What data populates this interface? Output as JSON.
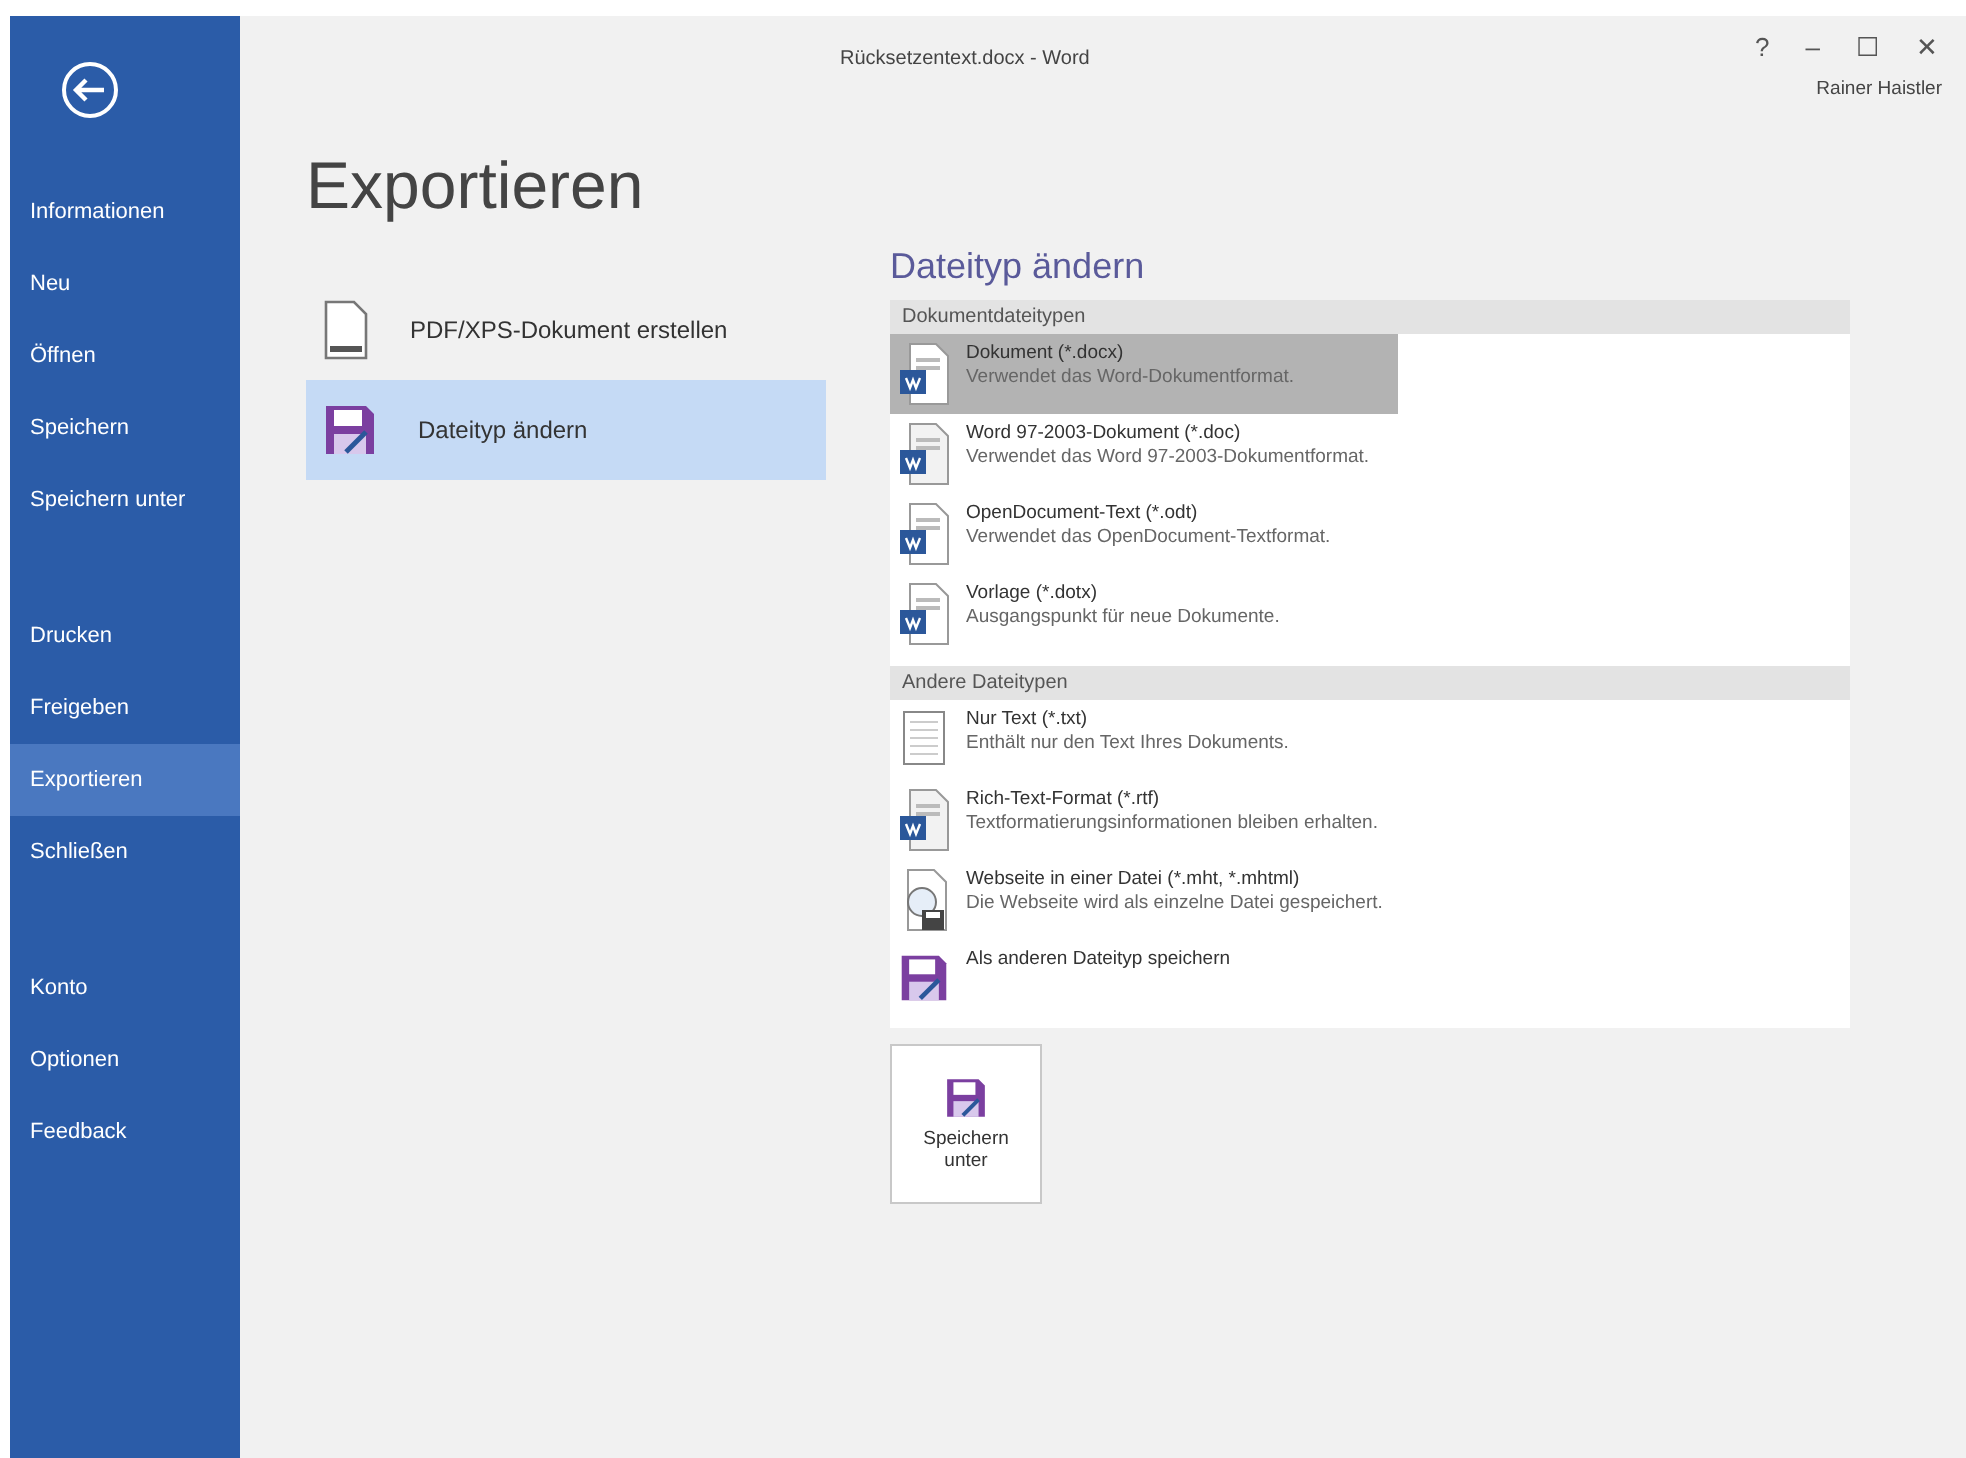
{
  "window": {
    "title": "Rücksetzentext.docx - Word",
    "controls": [
      "?",
      "–",
      "☐",
      "✕"
    ],
    "user": "Rainer Haistler"
  },
  "sidebar": {
    "groups": [
      [
        {
          "label": "Informationen",
          "selected": false
        },
        {
          "label": "Neu",
          "selected": false
        },
        {
          "label": "Öffnen",
          "selected": false
        },
        {
          "label": "Speichern",
          "selected": false
        },
        {
          "label": "Speichern unter",
          "selected": false
        }
      ],
      [
        {
          "label": "Drucken",
          "selected": false
        },
        {
          "label": "Freigeben",
          "selected": false
        },
        {
          "label": "Exportieren",
          "selected": true
        },
        {
          "label": "Schließen",
          "selected": false
        }
      ],
      [
        {
          "label": "Konto",
          "selected": false
        },
        {
          "label": "Optionen",
          "selected": false
        },
        {
          "label": "Feedback",
          "selected": false
        }
      ]
    ]
  },
  "page_title": "Exportieren",
  "options": [
    {
      "kind": "pdf",
      "label": "PDF/XPS-Dokument erstellen",
      "selected": false
    },
    {
      "kind": "save",
      "label": "Dateityp ändern",
      "selected": true
    }
  ],
  "detail": {
    "heading": "Dateityp ändern",
    "sections": [
      {
        "title": "Dokumentdateitypen",
        "items": [
          {
            "kind": "word",
            "name": "Dokument (*.docx)",
            "description": "Verwendet das Word-Dokumentformat.",
            "selected": true
          },
          {
            "kind": "word97",
            "name": "Word 97-2003-Dokument (*.doc)",
            "description": "Verwendet das Word 97-2003-Dokumentformat.",
            "selected": false
          },
          {
            "kind": "word",
            "name": "OpenDocument-Text (*.odt)",
            "description": "Verwendet das OpenDocument-Textformat.",
            "selected": false
          },
          {
            "kind": "word",
            "name": "Vorlage (*.dotx)",
            "description": "Ausgangspunkt für neue Dokumente.",
            "selected": false
          }
        ]
      },
      {
        "title": "Andere Dateitypen",
        "items": [
          {
            "kind": "plain",
            "name": "Nur Text (*.txt)",
            "description": "Enthält nur den Text Ihres Dokuments.",
            "selected": false
          },
          {
            "kind": "word97",
            "name": "Rich-Text-Format (*.rtf)",
            "description": "Textformatierungsinformationen bleiben erhalten.",
            "selected": false
          },
          {
            "kind": "web",
            "name": "Webseite in einer Datei (*.mht, *.mhtml)",
            "description": "Die Webseite wird als einzelne Datei gespeichert.",
            "selected": false
          },
          {
            "kind": "save",
            "name": "Als anderen Dateityp speichern",
            "selected": false
          }
        ]
      }
    ],
    "button": "Speichern unter"
  }
}
